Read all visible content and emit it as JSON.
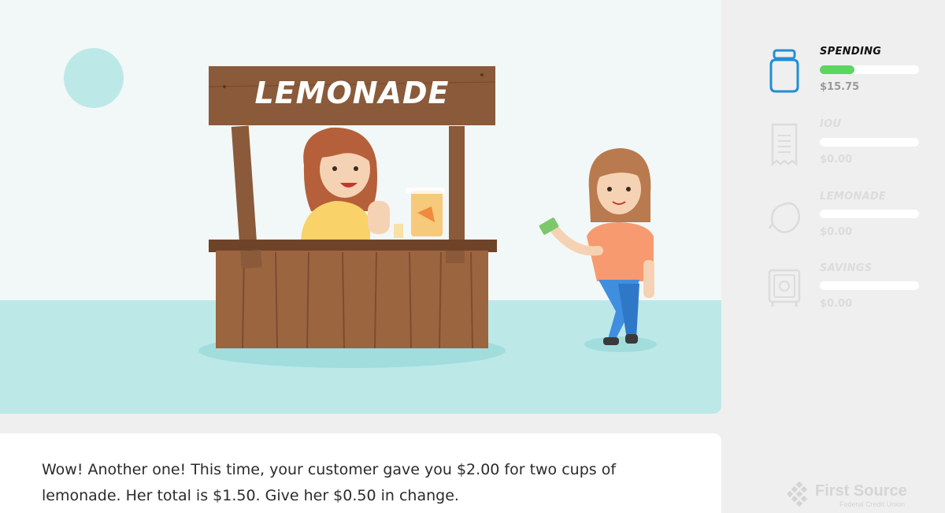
{
  "scene": {
    "sign_text": "LEMONADE"
  },
  "dialog": {
    "text": "Wow! Another one! This time, your customer gave you $2.00 for two cups of lemonade. Her total is $1.50. Give her $0.50 in change."
  },
  "jars": [
    {
      "title": "SPENDING",
      "amount": "$15.75",
      "progress": 0.35,
      "icon": "jar-icon",
      "active": true
    },
    {
      "title": "IOU",
      "amount": "$0.00",
      "progress": 0,
      "icon": "receipt-icon",
      "active": false
    },
    {
      "title": "LEMONADE",
      "amount": "$0.00",
      "progress": 0,
      "icon": "lemon-icon",
      "active": false
    },
    {
      "title": "SAVINGS",
      "amount": "$0.00",
      "progress": 0,
      "icon": "safe-icon",
      "active": false
    }
  ],
  "logo": {
    "name": "First Source",
    "subtitle": "Federal Credit Union"
  },
  "colors": {
    "progress_fill": "#5bd660",
    "active_icon": "#1f8fd6",
    "inactive": "#dcdcdc",
    "ground": "#bde8e8"
  }
}
